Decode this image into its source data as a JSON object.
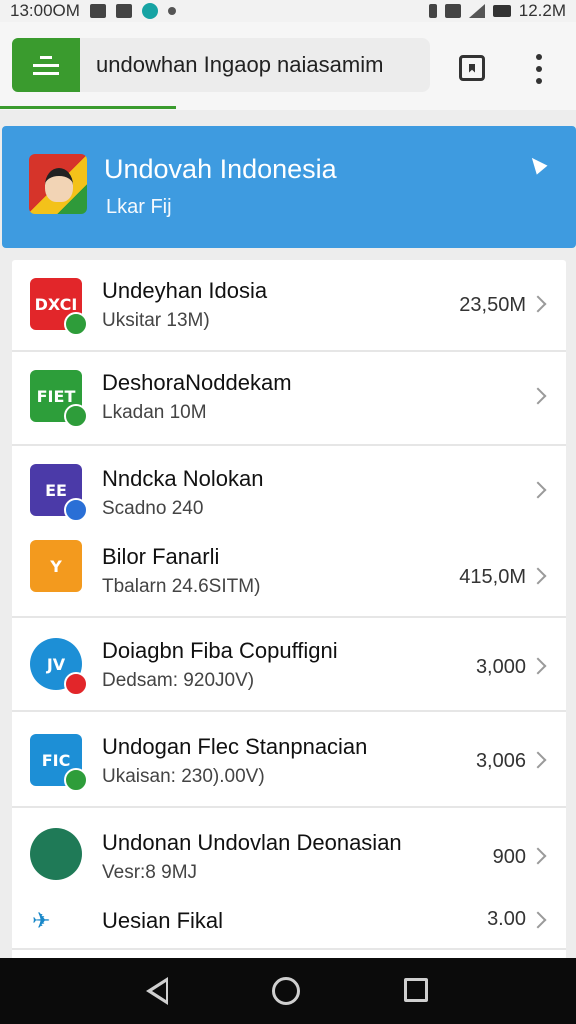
{
  "status_bar": {
    "time_left": "13:00OM",
    "time_right": "12.2M"
  },
  "search": {
    "value": "undowhan Ingaop naiasamim"
  },
  "hero": {
    "title": "Undovah Indonesia",
    "subtitle": "Lkar Fij"
  },
  "items": [
    {
      "title": "Undeyhan Idosia",
      "sub": "Uksitar 13M)",
      "size": "23,50M",
      "icon_text": "DXCI",
      "icon_color": "#e2262a",
      "badge_color": "#2e9d3a"
    },
    {
      "title": "DeshoraNoddekam",
      "sub": "Lkadan 10M",
      "size": "",
      "icon_text": "FIET",
      "icon_color": "#2d9e3a",
      "badge_color": "#2e9d3a"
    },
    {
      "title": "Nndcka Nolokan",
      "sub": "Scadno 240",
      "size": "",
      "icon_text": "EE",
      "icon_color": "#4b3aa8",
      "badge_color": "#2a6fd6"
    },
    {
      "title": "Bilor Fanarli",
      "sub": "Tbalarn 24.6SITM)",
      "size": "415,0M",
      "icon_text": "Y",
      "icon_color": "#f39a1e",
      "badge_color": ""
    },
    {
      "title": "Doiagbn Fiba Copuffigni",
      "sub": "Dedsam: 920J0V)",
      "size": "3,000",
      "icon_text": "JV",
      "icon_color": "#1d8fd6",
      "badge_color": "#e2262a"
    },
    {
      "title": "Undogan Flec Stanpnacian",
      "sub": "Ukaisan: 230).00V)",
      "size": "3,006",
      "icon_text": "FIC",
      "icon_color": "#1d8fd6",
      "badge_color": "#2e9d3a"
    },
    {
      "title": "Undonan Undovlan Deonasian",
      "sub": "Vesr:8 9MJ",
      "size": "900",
      "icon_text": "",
      "icon_color": "#1f7a57",
      "badge_color": ""
    },
    {
      "title": "Uesian Fikal",
      "sub": "",
      "size": "3.00",
      "icon_text": "",
      "icon_color": "#1a88c9",
      "badge_color": ""
    }
  ]
}
